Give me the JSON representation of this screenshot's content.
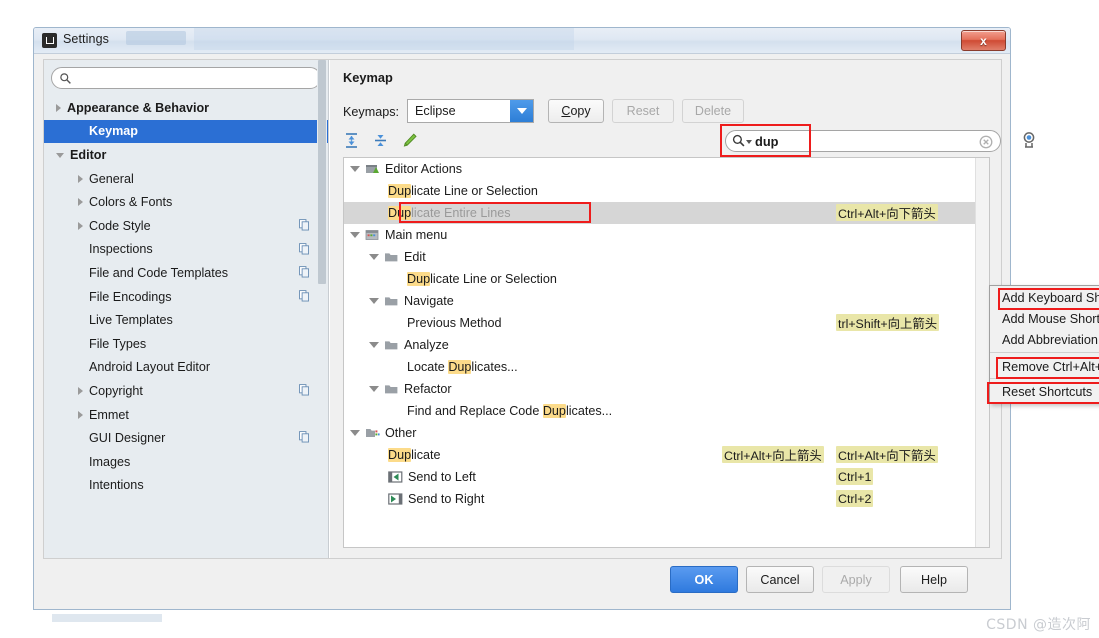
{
  "window": {
    "title": "Settings",
    "close_label": "x",
    "app_icon": "intellij-icon"
  },
  "sidebar": {
    "search_placeholder": "",
    "search_value": "",
    "items": [
      {
        "label": "Appearance & Behavior",
        "indent": 0,
        "arrow": "right",
        "bold": true,
        "selected": false,
        "copy": false
      },
      {
        "label": "Keymap",
        "indent": 1,
        "arrow": "none",
        "bold": true,
        "selected": true,
        "copy": false
      },
      {
        "label": "Editor",
        "indent": 0,
        "arrow": "down",
        "bold": true,
        "selected": false,
        "copy": false
      },
      {
        "label": "General",
        "indent": 1,
        "arrow": "right",
        "bold": false,
        "selected": false,
        "copy": false
      },
      {
        "label": "Colors & Fonts",
        "indent": 1,
        "arrow": "right",
        "bold": false,
        "selected": false,
        "copy": false
      },
      {
        "label": "Code Style",
        "indent": 1,
        "arrow": "right",
        "bold": false,
        "selected": false,
        "copy": true
      },
      {
        "label": "Inspections",
        "indent": 1,
        "arrow": "none",
        "bold": false,
        "selected": false,
        "copy": true
      },
      {
        "label": "File and Code Templates",
        "indent": 1,
        "arrow": "none",
        "bold": false,
        "selected": false,
        "copy": true
      },
      {
        "label": "File Encodings",
        "indent": 1,
        "arrow": "none",
        "bold": false,
        "selected": false,
        "copy": true
      },
      {
        "label": "Live Templates",
        "indent": 1,
        "arrow": "none",
        "bold": false,
        "selected": false,
        "copy": false
      },
      {
        "label": "File Types",
        "indent": 1,
        "arrow": "none",
        "bold": false,
        "selected": false,
        "copy": false
      },
      {
        "label": "Android Layout Editor",
        "indent": 1,
        "arrow": "none",
        "bold": false,
        "selected": false,
        "copy": false
      },
      {
        "label": "Copyright",
        "indent": 1,
        "arrow": "right",
        "bold": false,
        "selected": false,
        "copy": true
      },
      {
        "label": "Emmet",
        "indent": 1,
        "arrow": "right",
        "bold": false,
        "selected": false,
        "copy": false
      },
      {
        "label": "GUI Designer",
        "indent": 1,
        "arrow": "none",
        "bold": false,
        "selected": false,
        "copy": true
      },
      {
        "label": "Images",
        "indent": 1,
        "arrow": "none",
        "bold": false,
        "selected": false,
        "copy": false
      },
      {
        "label": "Intentions",
        "indent": 1,
        "arrow": "none",
        "bold": false,
        "selected": false,
        "copy": false
      }
    ]
  },
  "keymap": {
    "pane_title": "Keymap",
    "keymaps_label": "Keymaps:",
    "selected_keymap": "Eclipse",
    "keymap_options": [
      "Eclipse"
    ],
    "buttons": {
      "copy": "Copy",
      "copy_mnemonic": "C",
      "copy_rest": "opy",
      "reset": "Reset",
      "delete": "Delete"
    },
    "toolbar_icons": [
      "expand-all-icon",
      "collapse-all-icon",
      "edit-shortcut-icon"
    ],
    "search": {
      "value": "dup",
      "clear_label": "clear-search-icon",
      "filter_label": "filter-shortcuts-icon"
    },
    "tree": [
      {
        "label": "Editor Actions",
        "pre": "",
        "hl": "",
        "post": "Editor Actions",
        "indent": 0,
        "tri": true,
        "icon": "editor-actions-icon",
        "selected": false,
        "shortcuts": []
      },
      {
        "label": "Duplicate Line or Selection",
        "pre": "",
        "hl": "Dup",
        "post": "licate Line or Selection",
        "indent": 2,
        "tri": false,
        "icon": "",
        "selected": false,
        "shortcuts": []
      },
      {
        "label": "Duplicate Entire Lines",
        "pre": "",
        "hl": "Dup",
        "post": "licate Entire Lines",
        "indent": 2,
        "tri": false,
        "icon": "",
        "selected": true,
        "shortcuts": [
          {
            "text": "Ctrl+Alt+向下箭头",
            "col": 2
          }
        ]
      },
      {
        "label": "Main menu",
        "pre": "",
        "hl": "",
        "post": "Main menu",
        "indent": 0,
        "tri": true,
        "icon": "main-menu-icon",
        "selected": false,
        "shortcuts": []
      },
      {
        "label": "Edit",
        "pre": "",
        "hl": "",
        "post": "Edit",
        "indent": 1,
        "tri": true,
        "icon": "folder-icon",
        "selected": false,
        "shortcuts": []
      },
      {
        "label": "Duplicate Line or Selection",
        "pre": "",
        "hl": "Dup",
        "post": "licate Line or Selection",
        "indent": 3,
        "tri": false,
        "icon": "",
        "selected": false,
        "shortcuts": []
      },
      {
        "label": "Navigate",
        "pre": "",
        "hl": "",
        "post": "Navigate",
        "indent": 1,
        "tri": true,
        "icon": "folder-icon",
        "selected": false,
        "shortcuts": []
      },
      {
        "label": "Previous Method",
        "pre": "",
        "hl": "",
        "post": "Previous Method",
        "indent": 3,
        "tri": false,
        "icon": "",
        "selected": false,
        "shortcuts": [
          {
            "text": "trl+Shift+向上箭头",
            "col": 2
          }
        ]
      },
      {
        "label": "Analyze",
        "pre": "",
        "hl": "",
        "post": "Analyze",
        "indent": 1,
        "tri": true,
        "icon": "folder-icon",
        "selected": false,
        "shortcuts": []
      },
      {
        "label": "Locate Duplicates...",
        "pre": "Locate ",
        "hl": "Dup",
        "post": "licates...",
        "indent": 3,
        "tri": false,
        "icon": "",
        "selected": false,
        "shortcuts": []
      },
      {
        "label": "Refactor",
        "pre": "",
        "hl": "",
        "post": "Refactor",
        "indent": 1,
        "tri": true,
        "icon": "folder-icon",
        "selected": false,
        "shortcuts": []
      },
      {
        "label": "Find and Replace Code Duplicates...",
        "pre": "Find and Replace Code ",
        "hl": "Dup",
        "post": "licates...",
        "indent": 3,
        "tri": false,
        "icon": "",
        "selected": false,
        "shortcuts": []
      },
      {
        "label": "Other",
        "pre": "",
        "hl": "",
        "post": "Other",
        "indent": 0,
        "tri": true,
        "icon": "other-icon",
        "selected": false,
        "shortcuts": []
      },
      {
        "label": "Duplicate",
        "pre": "",
        "hl": "Dup",
        "post": "licate",
        "indent": 2,
        "tri": false,
        "icon": "",
        "selected": false,
        "shortcuts": [
          {
            "text": "Ctrl+Alt+向上箭头",
            "col": 1
          },
          {
            "text": "Ctrl+Alt+向下箭头",
            "col": 2
          }
        ]
      },
      {
        "label": "Send to Left",
        "pre": "",
        "hl": "",
        "post": "Send to Left",
        "indent": 2,
        "tri": false,
        "icon": "send-left-icon",
        "selected": false,
        "shortcuts": [
          {
            "text": "Ctrl+1",
            "col": 2
          }
        ]
      },
      {
        "label": "Send to Right",
        "pre": "",
        "hl": "",
        "post": "Send to Right",
        "indent": 2,
        "tri": false,
        "icon": "send-right-icon",
        "selected": false,
        "shortcuts": [
          {
            "text": "Ctrl+2",
            "col": 2
          }
        ]
      }
    ]
  },
  "context_menu": {
    "items": [
      {
        "label": "Add Keyboard Shortcut",
        "sep_before": false,
        "highlighted": true
      },
      {
        "label": "Add Mouse Shortcut",
        "sep_before": false,
        "highlighted": false
      },
      {
        "label": "Add Abbreviation",
        "sep_before": false,
        "highlighted": false
      },
      {
        "label": "Remove Ctrl+Alt+向下箭头",
        "sep_before": true,
        "highlighted": true
      },
      {
        "label": "Reset Shortcuts",
        "sep_before": true,
        "highlighted": true
      }
    ]
  },
  "footer": {
    "ok": "OK",
    "cancel": "Cancel",
    "apply": "Apply",
    "help": "Help"
  },
  "watermark": "CSDN @造次阿",
  "colors": {
    "accent": "#2b6fd4",
    "selection_grey": "#d6d6d6",
    "highlight_yellow": "#fcdb8a",
    "shortcut_yellow": "#e9e6a8",
    "annotation_red": "#ee1c1c"
  }
}
